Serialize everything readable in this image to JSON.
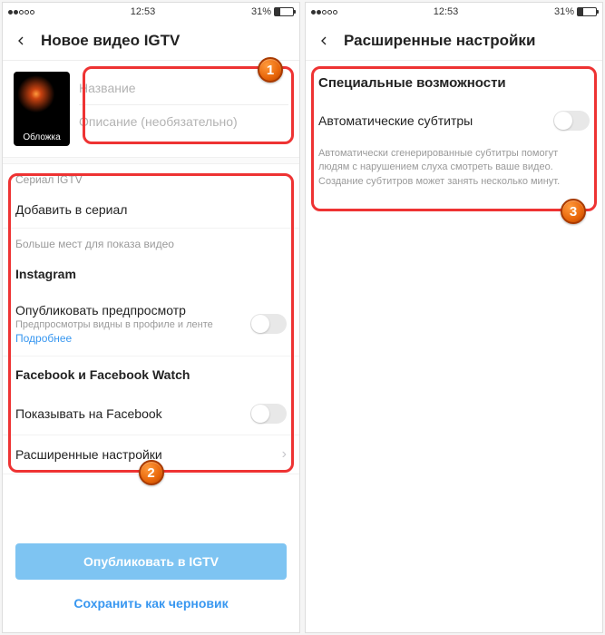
{
  "statusbar": {
    "time": "12:53",
    "battery": "31%"
  },
  "screen1": {
    "title": "Новое видео IGTV",
    "cover_label": "Обложка",
    "fields": {
      "title_placeholder": "Название",
      "description_placeholder": "Описание (необязательно)"
    },
    "series_label": "Сериал IGTV",
    "add_series": "Добавить в сериал",
    "more_places_label": "Больше мест для показа видео",
    "instagram": "Instagram",
    "preview_label": "Опубликовать предпросмотр",
    "preview_sub": "Предпросмотры видны в профиле и ленте",
    "preview_link": "Подробнее",
    "facebook_label": "Facebook и Facebook Watch",
    "show_facebook": "Показывать на Facebook",
    "advanced": "Расширенные настройки",
    "publish_btn": "Опубликовать в IGTV",
    "draft_btn": "Сохранить как черновик"
  },
  "screen2": {
    "title": "Расширенные настройки",
    "section": "Специальные возможности",
    "auto_captions": "Автоматические субтитры",
    "helper": "Автоматически сгенерированные субтитры помогут людям с нарушением слуха смотреть ваше видео. Создание субтитров может занять несколько минут."
  },
  "badges": {
    "b1": "1",
    "b2": "2",
    "b3": "3"
  }
}
